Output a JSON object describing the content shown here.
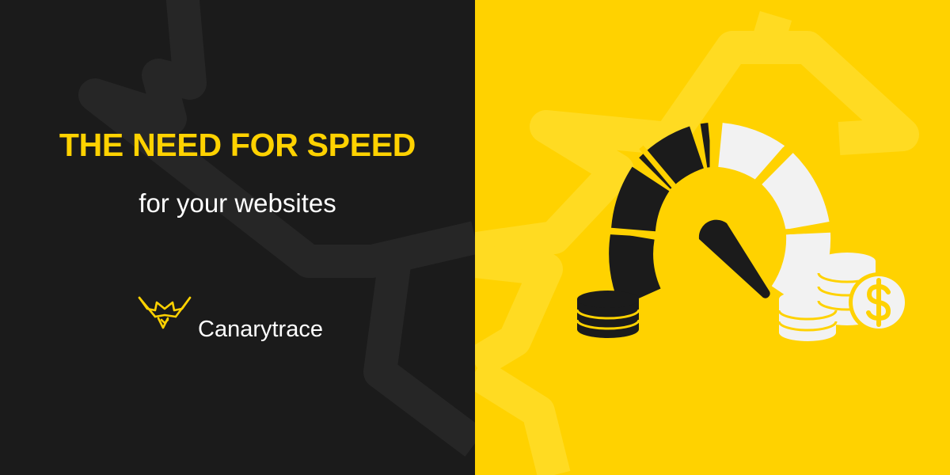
{
  "banner": {
    "headline": "THE NEED FOR SPEED",
    "subheadline": "for your websites",
    "brand": {
      "name": "Canarytrace",
      "logo_icon": "canary-bird-logo-icon"
    },
    "illustration": {
      "icons": [
        "speedometer-icon",
        "coin-stack-icon",
        "dollar-coin-icon"
      ]
    },
    "colors": {
      "dark_background": "#1b1b1b",
      "accent_yellow": "#ffd200",
      "text_white": "#ffffff",
      "gauge_dark": "#1b1b1b",
      "gauge_light": "#f2f2f2"
    }
  }
}
